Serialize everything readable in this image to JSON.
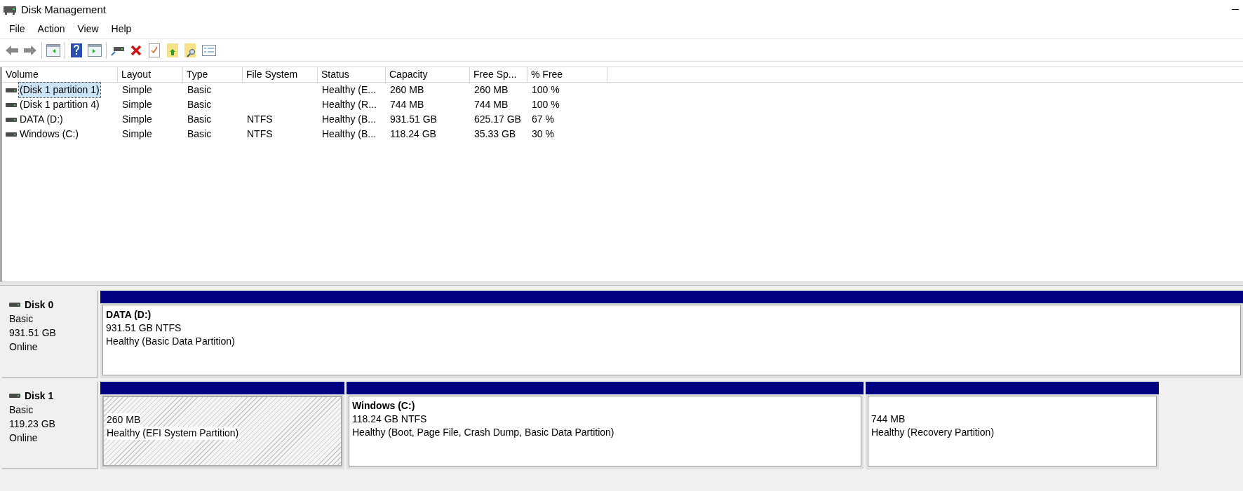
{
  "window": {
    "title": "Disk Management"
  },
  "menu": [
    "File",
    "Action",
    "View",
    "Help"
  ],
  "table": {
    "columns": [
      "Volume",
      "Layout",
      "Type",
      "File System",
      "Status",
      "Capacity",
      "Free Sp...",
      "% Free"
    ],
    "rows": [
      {
        "cells": [
          "(Disk 1 partition 1)",
          "Simple",
          "Basic",
          "",
          "Healthy (E...",
          "260 MB",
          "260 MB",
          "100 %"
        ],
        "selected": true
      },
      {
        "cells": [
          "(Disk 1 partition 4)",
          "Simple",
          "Basic",
          "",
          "Healthy (R...",
          "744 MB",
          "744 MB",
          "100 %"
        ],
        "selected": false
      },
      {
        "cells": [
          "DATA (D:)",
          "Simple",
          "Basic",
          "NTFS",
          "Healthy (B...",
          "931.51 GB",
          "625.17 GB",
          "67 %"
        ],
        "selected": false
      },
      {
        "cells": [
          "Windows (C:)",
          "Simple",
          "Basic",
          "NTFS",
          "Healthy (B...",
          "118.24 GB",
          "35.33 GB",
          "30 %"
        ],
        "selected": false
      }
    ]
  },
  "disks": [
    {
      "name": "Disk 0",
      "type": "Basic",
      "size": "931.51 GB",
      "status": "Online",
      "partitions": [
        {
          "title": "DATA  (D:)",
          "size": "931.51 GB NTFS",
          "status": "Healthy (Basic Data Partition)",
          "selected": false
        }
      ]
    },
    {
      "name": "Disk 1",
      "type": "Basic",
      "size": "119.23 GB",
      "status": "Online",
      "partitions": [
        {
          "size": "260 MB",
          "status": "Healthy (EFI System Partition)",
          "selected": true
        },
        {
          "title": "Windows  (C:)",
          "size": "118.24 GB NTFS",
          "status": "Healthy (Boot, Page File, Crash Dump, Basic Data Partition)",
          "selected": false
        },
        {
          "size": "744 MB",
          "status": "Healthy (Recovery Partition)",
          "selected": false
        }
      ]
    }
  ]
}
